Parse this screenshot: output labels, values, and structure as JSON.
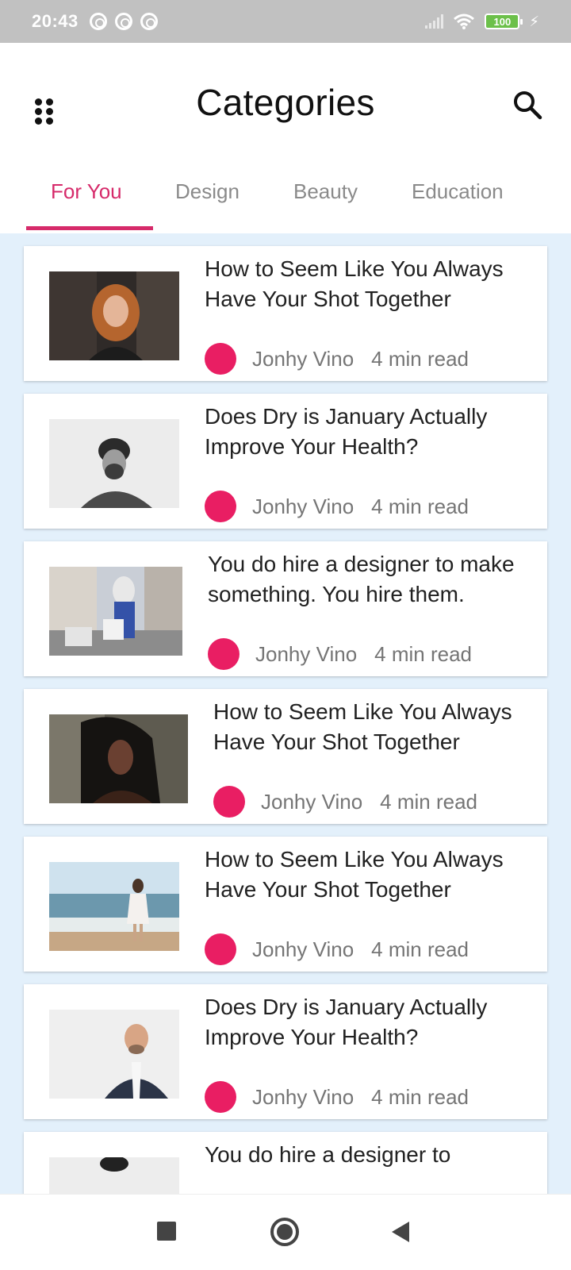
{
  "status_bar": {
    "time": "20:43",
    "icons": [
      "alarm-icon",
      "sync-icon",
      "sync-icon",
      "signal-icon",
      "wifi-icon",
      "battery-icon",
      "charging-icon"
    ],
    "battery_label": "100"
  },
  "app_bar": {
    "title": "Categories",
    "menu_icon": "grid-dots-icon",
    "search_icon": "search-icon"
  },
  "tabs": [
    {
      "label": "For You",
      "active": true
    },
    {
      "label": "Design",
      "active": false
    },
    {
      "label": "Beauty",
      "active": false
    },
    {
      "label": "Education",
      "active": false
    }
  ],
  "colors": {
    "accent": "#d62a6a",
    "author_dot": "#e91e63",
    "list_background": "#e3f0fb"
  },
  "articles": [
    {
      "title": "How to Seem Like You Always Have Your Shot Together",
      "author": "Jonhy Vino",
      "read_time": "4 min read"
    },
    {
      "title": "Does Dry is January Actually Improve Your Health?",
      "author": "Jonhy Vino",
      "read_time": "4 min read"
    },
    {
      "title": "You do hire a designer to make something. You hire them.",
      "author": "Jonhy Vino",
      "read_time": "4 min read"
    },
    {
      "title": "How to Seem Like You Always Have Your Shot Together",
      "author": "Jonhy Vino",
      "read_time": "4 min read"
    },
    {
      "title": "How to Seem Like You Always Have Your Shot Together",
      "author": "Jonhy Vino",
      "read_time": "4 min read"
    },
    {
      "title": "Does Dry is January Actually Improve Your Health?",
      "author": "Jonhy Vino",
      "read_time": "4 min read"
    },
    {
      "title": "You do hire a designer to",
      "author": "",
      "read_time": ""
    }
  ],
  "nav_bar": {
    "icons": [
      "recents-square-icon",
      "home-circle-icon",
      "back-triangle-icon"
    ]
  }
}
